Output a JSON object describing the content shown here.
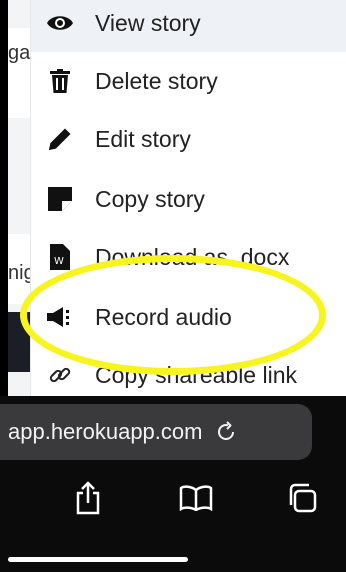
{
  "background_page": {
    "row1_fragment": "ga",
    "row2_fragment": "nig"
  },
  "menu": {
    "items": [
      {
        "label": "View story",
        "icon": "eye-icon"
      },
      {
        "label": "Delete story",
        "icon": "trash-icon"
      },
      {
        "label": "Edit story",
        "icon": "pencil-icon"
      },
      {
        "label": "Copy story",
        "icon": "sticky-note-icon"
      },
      {
        "label": "Download as .docx",
        "icon": "word-file-icon"
      },
      {
        "label": "Record audio",
        "icon": "megaphone-icon"
      },
      {
        "label": "Copy shareable link",
        "icon": "link-icon"
      }
    ]
  },
  "browser": {
    "url": "app.herokuapp.com",
    "reload_icon": "reload-icon",
    "toolbar": [
      "share-icon",
      "bookmarks-icon",
      "tabs-icon"
    ]
  },
  "annotation": {
    "color": "#f7f41f",
    "target": "Record audio"
  }
}
